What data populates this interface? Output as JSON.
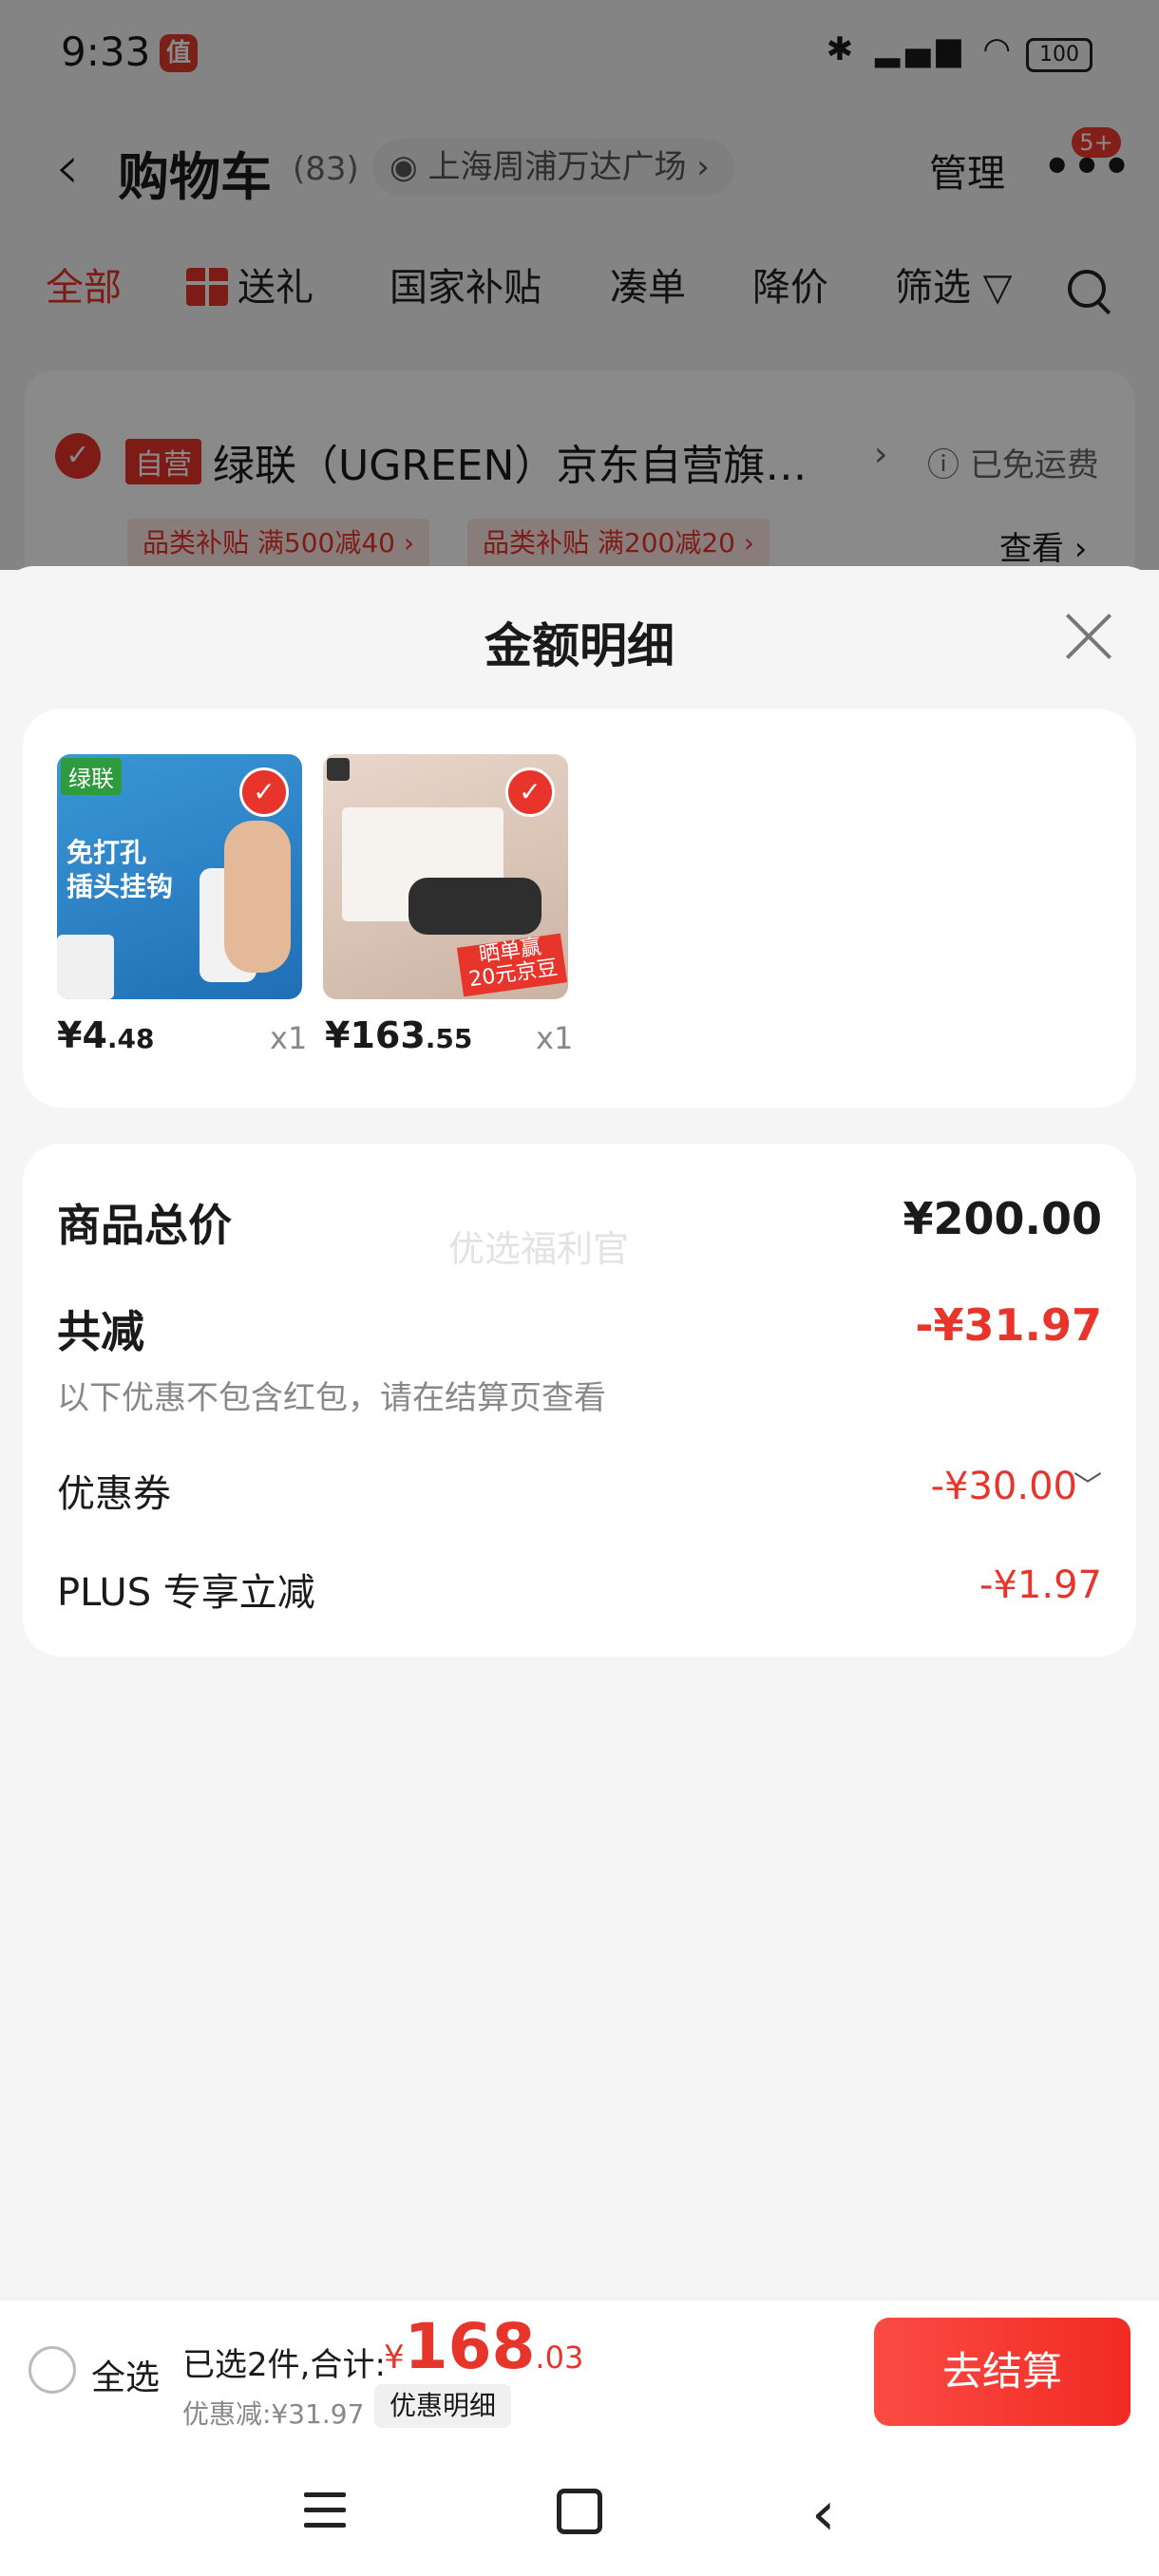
{
  "status_bar": {
    "time": "9:33",
    "app_badge": "值",
    "signal": "HD",
    "battery": "100"
  },
  "header": {
    "title": "购物车",
    "count": "(83)",
    "location": "上海周浦万达广场",
    "manage": "管理",
    "more_badge": "5+"
  },
  "tabs": [
    "全部",
    "送礼",
    "国家补贴",
    "凑单",
    "降价",
    "筛选"
  ],
  "store": {
    "tag": "自营",
    "name": "绿联（UGREEN）京东自营旗…",
    "free_shipping": "已免运费",
    "coupons": [
      "品类补贴 满500减40 ›",
      "品类补贴 满200减20 ›"
    ],
    "view": "查看 ›"
  },
  "sheet": {
    "title": "金额明细",
    "products": [
      {
        "brand": "绿联",
        "headline": "免打孔\n插头挂钩",
        "price_int": "¥4",
        "price_dec": ".48",
        "qty": "x1"
      },
      {
        "brand": "mi",
        "promo": "晒单赢\n20元京豆",
        "price_int": "¥163",
        "price_dec": ".55",
        "qty": "x1"
      }
    ],
    "total_label": "商品总价",
    "total_value": "¥200.00",
    "reduce_label": "共减",
    "reduce_value": "-¥31.97",
    "reduce_note": "以下优惠不包含红包，请在结算页查看",
    "coupon_label": "优惠券",
    "coupon_value": "-¥30.00",
    "plus_label": "PLUS 专享立减",
    "plus_value": "-¥1.97",
    "watermark": "优选福利官"
  },
  "bottom": {
    "select_all": "全选",
    "selected": "已选2件,合计:",
    "currency": "¥",
    "amount_int": "168",
    "amount_dec": ".03",
    "discount": "优惠减:¥31.97",
    "detail": "优惠明细",
    "checkout": "去结算"
  },
  "colors": {
    "accent": "#e8352c",
    "brand_green": "#2d9b3e"
  }
}
